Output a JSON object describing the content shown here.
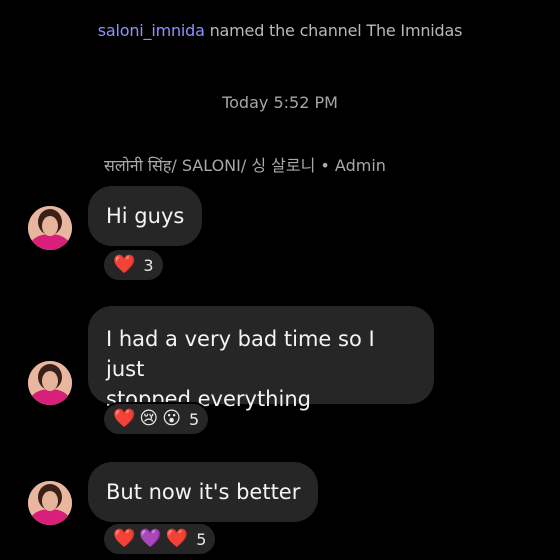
{
  "system_event": {
    "username": "saloni_imnida",
    "text": " named the channel The Imnidas"
  },
  "timestamp": "Today 5:52 PM",
  "sender_label": "सलोनी सिंह/ SALONI/ 싱 살로니 • Admin",
  "messages": [
    {
      "text": "Hi guys",
      "reactions": {
        "emojis": [
          "❤️"
        ],
        "count": "3"
      }
    },
    {
      "line1": "I had a very bad time so I just",
      "line2": "stopped everything",
      "reactions": {
        "emojis": [
          "❤️",
          "😢",
          "😮"
        ],
        "count": "5"
      }
    },
    {
      "text": "But now it's better",
      "reactions": {
        "emojis": [
          "❤️",
          "💜",
          "❤️"
        ],
        "count": "5"
      }
    }
  ],
  "colors": {
    "background": "#000000",
    "bubble": "#262626",
    "username_accent": "#8f90ff"
  }
}
